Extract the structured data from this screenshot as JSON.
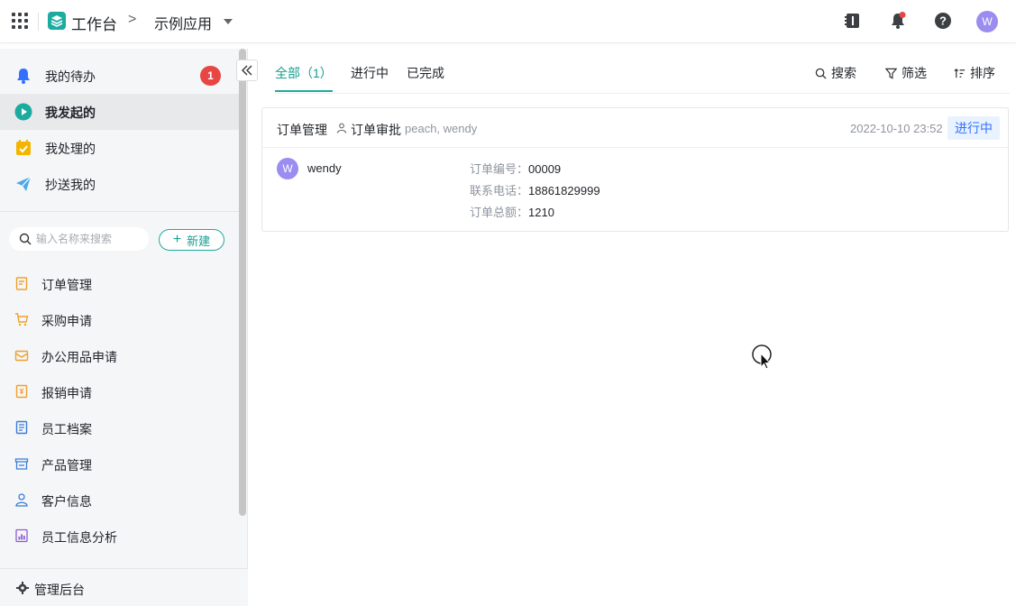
{
  "header": {
    "brand": "工作台",
    "breadcrumb_sep": ">",
    "app_name": "示例应用",
    "user_initial": "W",
    "colors": {
      "brand": "#1cab9f",
      "avatar": "#9b8cf0",
      "notify_dot": "#e84545"
    },
    "icons": [
      "apps-grid-icon",
      "workbench-logo-icon",
      "notebook-icon",
      "bell-icon",
      "help-icon"
    ]
  },
  "sidebar": {
    "nav": [
      {
        "label": "我的待办",
        "icon": "bell-icon",
        "badge": "1",
        "active": false
      },
      {
        "label": "我发起的",
        "icon": "play-icon",
        "active": true
      },
      {
        "label": "我处理的",
        "icon": "check-icon",
        "active": false
      },
      {
        "label": "抄送我的",
        "icon": "send-icon",
        "active": false
      }
    ],
    "search_placeholder": "输入名称来搜索",
    "new_button": "新建",
    "apps": [
      {
        "label": "订单管理",
        "icon": "clipboard-icon"
      },
      {
        "label": "采购申请",
        "icon": "cart-icon"
      },
      {
        "label": "办公用品申请",
        "icon": "envelope-icon"
      },
      {
        "label": "报销申请",
        "icon": "receipt-icon"
      },
      {
        "label": "员工档案",
        "icon": "document-icon"
      },
      {
        "label": "产品管理",
        "icon": "store-icon"
      },
      {
        "label": "客户信息",
        "icon": "person-icon"
      },
      {
        "label": "员工信息分析",
        "icon": "chart-icon"
      }
    ],
    "admin": "管理后台"
  },
  "tabs": [
    {
      "label": "全部（1）",
      "active": true
    },
    {
      "label": "进行中",
      "active": false
    },
    {
      "label": "已完成",
      "active": false
    }
  ],
  "toolbar": {
    "search": "搜索",
    "filter": "筛选",
    "sort": "排序"
  },
  "card": {
    "title": "订单管理",
    "flow": "订单审批",
    "participants": "peach, wendy",
    "time": "2022-10-10 23:52",
    "status": "进行中",
    "user_initial": "W",
    "user": "wendy",
    "fields": [
      {
        "key": "订单编号：",
        "value": "00009"
      },
      {
        "key": "联系电话：",
        "value": "18861829999"
      },
      {
        "key": "订单总额：",
        "value": "1210"
      }
    ]
  }
}
